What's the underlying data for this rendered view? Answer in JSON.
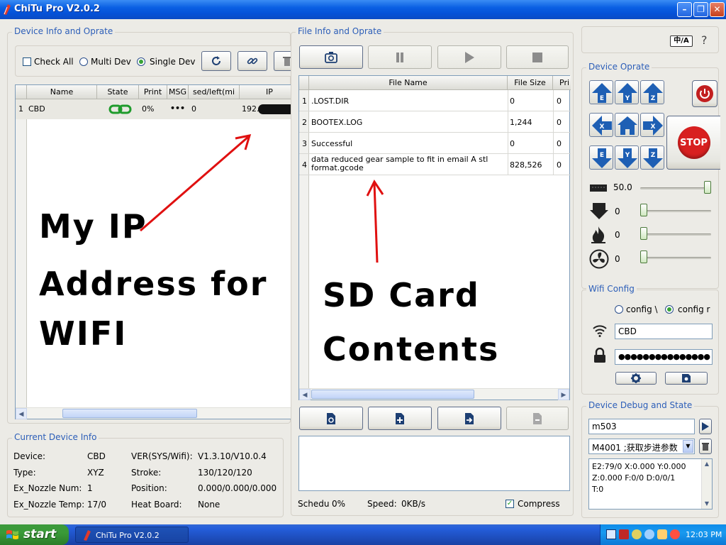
{
  "window": {
    "title": "ChiTu Pro V2.0.2"
  },
  "device_panel": {
    "group_title": "Device Info and Oprate",
    "check_all": "Check All",
    "multi_dev": "Multi Dev",
    "single_dev": "Single Dev",
    "columns": [
      "Name",
      "State",
      "Print",
      "MSG",
      "sed/left(mi",
      "IP"
    ],
    "rows": [
      {
        "index": "1",
        "name": "CBD",
        "print": "0%",
        "msg": "•••",
        "time": "0",
        "ip": "192."
      }
    ]
  },
  "file_panel": {
    "group_title": "File Info and Oprate",
    "columns": [
      "File Name",
      "File Size",
      "Pri"
    ],
    "rows": [
      {
        "index": "1",
        "name": ".LOST.DIR",
        "size": "0",
        "pri": "0"
      },
      {
        "index": "2",
        "name": "BOOTEX.LOG",
        "size": "1,244",
        "pri": "0"
      },
      {
        "index": "3",
        "name": "Successful",
        "size": "0",
        "pri": "0"
      },
      {
        "index": "4",
        "name": "data reduced gear sample to fit in email A stl format.gcode",
        "size": "828,526",
        "pri": "0"
      }
    ],
    "schedu_label": "Schedu",
    "schedu_value": "0%",
    "speed_label": "Speed:",
    "speed_value": "0KB/s",
    "compress_label": "Compress"
  },
  "annotations": {
    "ip_note": [
      "My IP",
      "Address for",
      "WIFI"
    ],
    "sd_note": [
      "SD Card",
      "Contents"
    ]
  },
  "current_device": {
    "group_title": "Current Device Info",
    "left": [
      {
        "label": "Device:",
        "value": "CBD"
      },
      {
        "label": "Type:",
        "value": "XYZ"
      },
      {
        "label": "Ex_Nozzle Num:",
        "value": "1"
      },
      {
        "label": "Ex_Nozzle Temp:",
        "value": "17/0"
      }
    ],
    "right": [
      {
        "label": "VER(SYS/Wifi):",
        "value": "V1.3.10/V10.0.4"
      },
      {
        "label": "Stroke:",
        "value": "130/120/120"
      },
      {
        "label": "Position:",
        "value": "0.000/0.000/0.000"
      },
      {
        "label": "Heat Board:",
        "value": "None"
      }
    ]
  },
  "device_oprate": {
    "group_title": "Device Oprate",
    "stop_label": "STOP",
    "dir_labels": {
      "e": "E",
      "y": "Y",
      "z": "Z",
      "x": "X"
    },
    "speed_value": "50.0",
    "speed_level": 1.0,
    "rows": [
      {
        "value": "0",
        "level": 0
      },
      {
        "value": "0",
        "level": 0
      },
      {
        "value": "0",
        "level": 0
      }
    ]
  },
  "wifi": {
    "group_title": "Wifi Config",
    "option1": "config \\",
    "option2": "config r",
    "ssid": "CBD",
    "password": "●●●●●●●●●●●●●●●"
  },
  "debug": {
    "group_title": "Device Debug and State",
    "command": "m503",
    "preset": "M4001 ;获取步进参数",
    "log": [
      "E2:79/0 X:0.000 Y:0.000",
      "Z:0.000 F:0/0 D:0/0/1",
      "T:0"
    ]
  },
  "taskbar": {
    "start": "start",
    "task": "ChiTu Pro V2.0.2",
    "clock": "12:03 PM"
  },
  "colors": {
    "accent": "#2c5eb8",
    "stop": "#d82020",
    "arrow_blue": "#1e5fb4",
    "annotation_red": "#e01010"
  }
}
